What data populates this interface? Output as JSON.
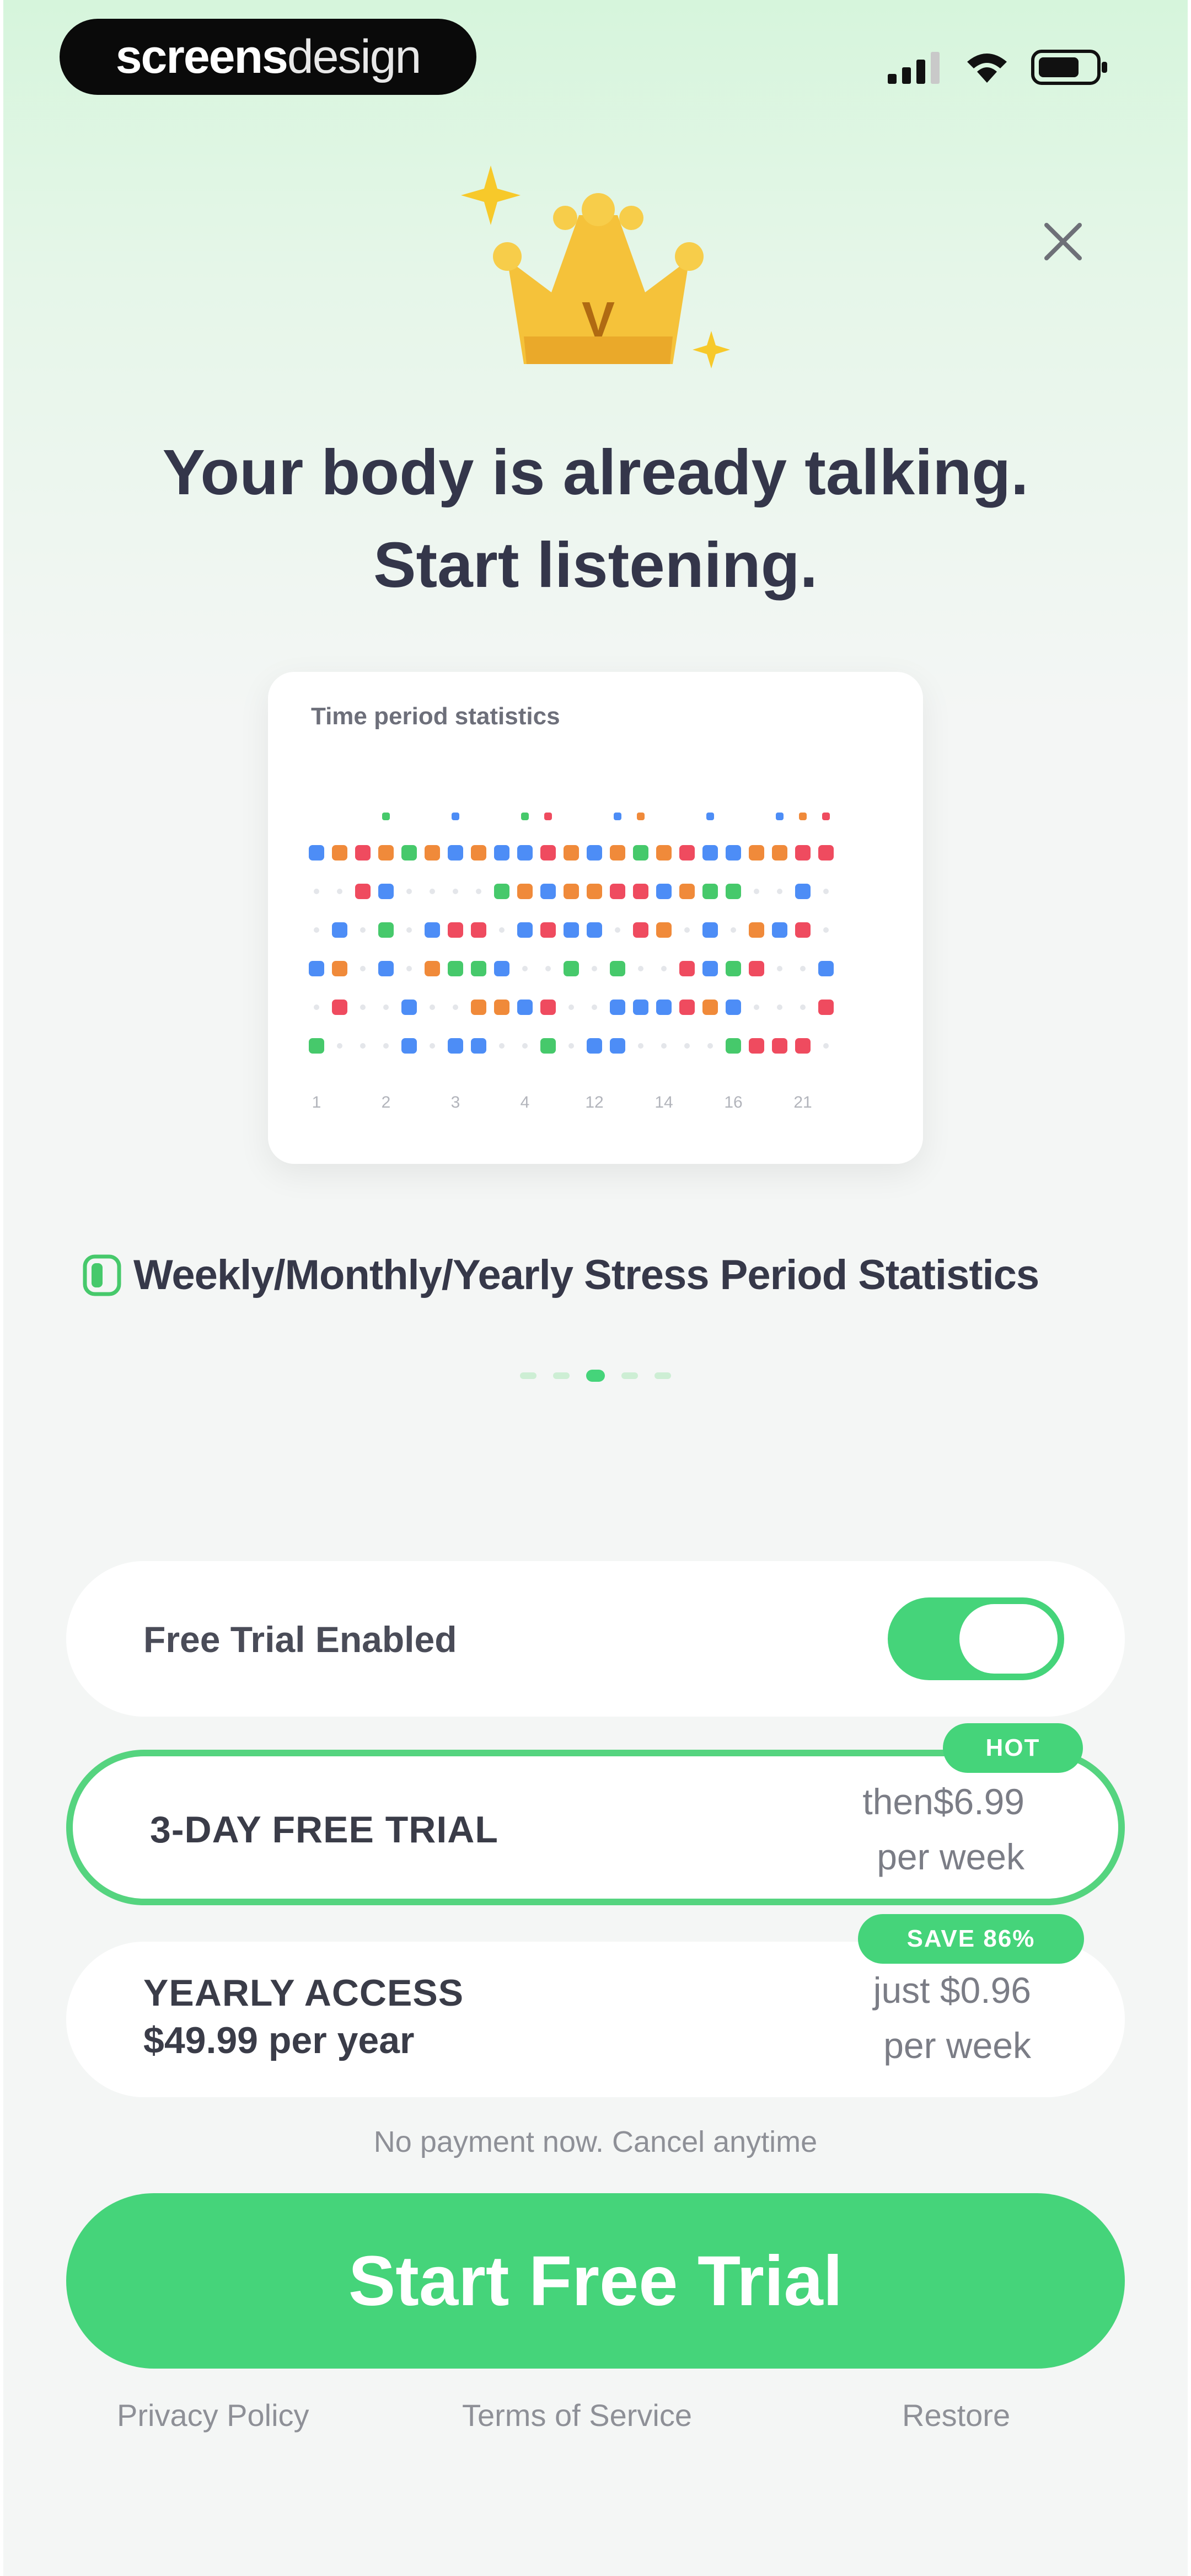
{
  "status_bar": {
    "brand_bold": "screens",
    "brand_light": "design",
    "signal_icon": "cellular-signal-icon",
    "wifi_icon": "wifi-icon",
    "battery_icon": "battery-icon"
  },
  "header": {
    "close_icon": "close-icon",
    "crown_icon": "crown-icon",
    "crown_letter": "V",
    "title_line1": "Your body is already talking.",
    "title_line2": "Start listening."
  },
  "stats_card": {
    "title": "Time period statistics",
    "x_ticks": [
      "1",
      "2",
      "3",
      "4",
      "12",
      "14",
      "16",
      "21"
    ],
    "colors": {
      "blue": "#4d8df6",
      "red": "#ef4b5f",
      "green": "#46c96b",
      "orange": "#f08a3a",
      "empty": "#e4e6ea"
    },
    "rows": [
      "BOROGOBOBBROBOGORBBOORR",
      "..RB....GOBOORRBOGG..B.",
      ".B.G.BRR.BRBB.RO.B.OBR.",
      "BO.B.OGGB..G.G..RBGR..B",
      ".R..B..OOBR..BBBROB...R",
      "G...B.BB..G.BB....GRRR."
    ],
    "top_marks": [
      {
        "col": 3,
        "c": "green"
      },
      {
        "col": 6,
        "c": "blue"
      },
      {
        "col": 9,
        "c": "green"
      },
      {
        "col": 10,
        "c": "red"
      },
      {
        "col": 13,
        "c": "blue"
      },
      {
        "col": 14,
        "c": "orange"
      },
      {
        "col": 17,
        "c": "blue"
      },
      {
        "col": 20,
        "c": "blue"
      },
      {
        "col": 21,
        "c": "orange"
      },
      {
        "col": 22,
        "c": "red"
      }
    ]
  },
  "feature": {
    "icon": "stats-toggle-icon",
    "text": "Weekly/Monthly/Yearly Stress Period Statistics"
  },
  "carousel": {
    "count": 5,
    "active_index": 2
  },
  "free_trial": {
    "label": "Free Trial Enabled",
    "enabled": true
  },
  "plans": [
    {
      "name": "3-DAY FREE TRIAL",
      "sub": "",
      "price_line1": "then$6.99",
      "price_line2": "per week",
      "badge": "HOT",
      "selected": true
    },
    {
      "name": "YEARLY ACCESS",
      "sub": "$49.99 per year",
      "price_line1": "just $0.96",
      "price_line2": "per week",
      "badge": "SAVE 86%",
      "selected": false
    }
  ],
  "no_payment_text": "No payment now. Cancel anytime",
  "cta_label": "Start Free Trial",
  "footer": {
    "privacy": "Privacy Policy",
    "terms": "Terms of Service",
    "restore": "Restore"
  },
  "theme": {
    "accent": "#45d47a"
  }
}
